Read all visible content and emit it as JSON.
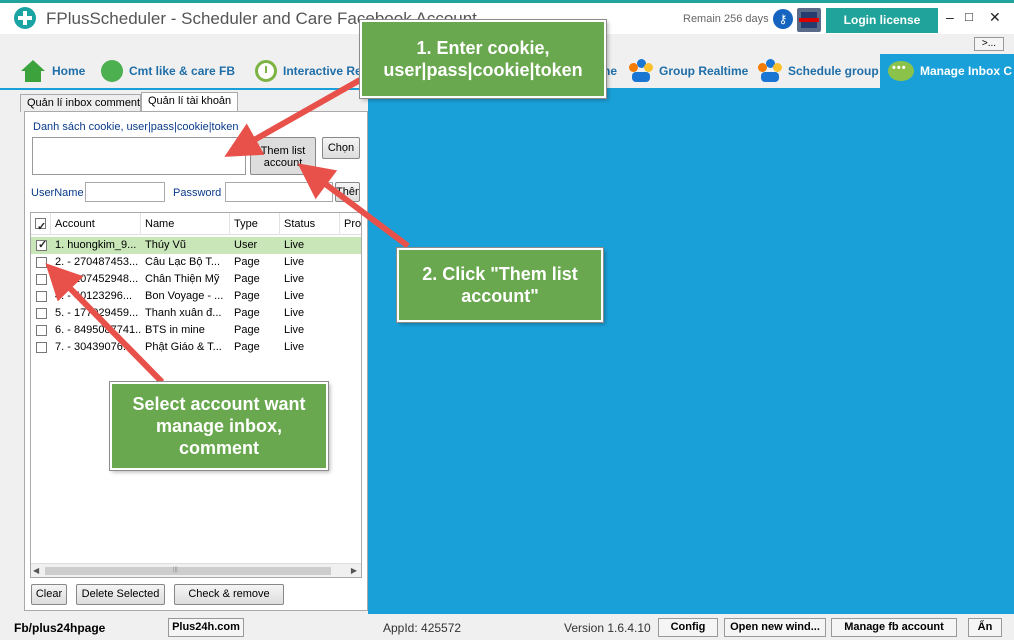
{
  "titlebar": {
    "title": "FPlusScheduler - Scheduler and Care Facebook Account",
    "remain": "Remain 256 days",
    "login_label": "Login license",
    "minimize": "–",
    "maximize": "□",
    "close": "✕"
  },
  "expand_label": ">...",
  "nav": {
    "home": "Home",
    "cmt_like": "Cmt like & care FB",
    "interactive": "Interactive Re",
    "home_partial": "ne",
    "group_realtime": "Group Realtime",
    "schedule_group": "Schedule group",
    "manage_inbox": "Manage Inbox C"
  },
  "tabs": {
    "inbox_comment": "Quản lí inbox comment",
    "account": "Quản lí tài khoản"
  },
  "form": {
    "list_label": "Danh sách cookie, user|pass|cookie|token",
    "add_list_button": "Them list account",
    "chon_button": "Chọn",
    "username_label": "UserName",
    "password_label": "Password",
    "them_button": "Thêm"
  },
  "table": {
    "headers": [
      "Account",
      "Name",
      "Type",
      "Status",
      "Pro"
    ],
    "rows": [
      {
        "account": "1. huongkim_9...",
        "name": "Thúy Vũ",
        "type": "User",
        "status": "Live",
        "checked": true
      },
      {
        "account": "2.  - 270487453...",
        "name": "Câu Lạc Bộ T...",
        "type": "Page",
        "status": "Live",
        "checked": false
      },
      {
        "account": "3.  - 207452948...",
        "name": "Chân Thiện Mỹ",
        "type": "Page",
        "status": "Live",
        "checked": false
      },
      {
        "account": "4.  - 40123296...",
        "name": "Bon Voyage - ...",
        "type": "Page",
        "status": "Live",
        "checked": false
      },
      {
        "account": "5.  - 177029459...",
        "name": "Thanh xuân đ...",
        "type": "Page",
        "status": "Live",
        "checked": false
      },
      {
        "account": "6.  - 8495087741...",
        "name": "BTS in mine",
        "type": "Page",
        "status": "Live",
        "checked": false
      },
      {
        "account": "7.  - 30439076...",
        "name": "Phật Giáo & T...",
        "type": "Page",
        "status": "Live",
        "checked": false
      }
    ]
  },
  "actions": {
    "clear": "Clear",
    "delete_selected": "Delete Selected",
    "check_remove": "Check & remove"
  },
  "callouts": {
    "step1_line1": "1. Enter cookie,",
    "step1_line2": "user|pass|cookie|token",
    "step2_line1": "2. Click \"Them list",
    "step2_line2": "account\"",
    "select_line1": "Select account want",
    "select_line2": "manage inbox,",
    "select_line3": "comment"
  },
  "statusbar": {
    "fb_link": "Fb/plus24hpage",
    "plus24h": "Plus24h.com",
    "appid": "AppId: 425572",
    "version": "Version 1.6.4.10",
    "config": "Config",
    "open_new": "Open new wind...",
    "manage_fb": "Manage fb account",
    "an": "Ẩn"
  },
  "colors": {
    "accent": "#1aa0d8",
    "title_accent": "#1fa39a",
    "callout": "#6aa84f",
    "arrow": "#e8504a",
    "selected_row": "#c8e6b8"
  }
}
